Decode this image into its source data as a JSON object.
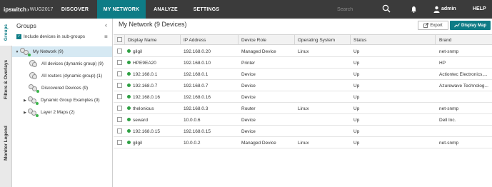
{
  "topbar": {
    "brand": "ipswitch",
    "version": "WUG2017",
    "nav": [
      "DISCOVER",
      "MY NETWORK",
      "ANALYZE",
      "SETTINGS"
    ],
    "active_nav": "MY NETWORK",
    "search_placeholder": "Search",
    "user": "admin",
    "help": "HELP"
  },
  "vertical_tabs": [
    "Groups",
    "Filters & Overlays",
    "Monitor Legend"
  ],
  "groups_panel": {
    "title": "Groups",
    "include_subgroups_label": "Include devices in sub-groups",
    "include_subgroups_checked": true,
    "tree": [
      {
        "label": "My Network (9)",
        "expanded": true,
        "selected": true
      },
      {
        "label": "All devices (dynamic group) (9)"
      },
      {
        "label": "All routers (dynamic group) (1)"
      },
      {
        "label": "Discovered Devices (9)"
      },
      {
        "label": "Dynamic Group Examples (9)",
        "collapsed": true
      },
      {
        "label": "Layer 2 Maps (2)",
        "collapsed": true
      }
    ]
  },
  "main": {
    "title": "My Network  (9 Devices)",
    "export_label": "Export",
    "display_map_label": "Display Map",
    "columns": [
      "Display Name",
      "IP Address",
      "Device Role",
      "Operating System",
      "Status",
      "Brand"
    ],
    "rows": [
      {
        "name": "gilgil",
        "ip": "192.168.0.20",
        "role": "Managed Device",
        "os": "Linux",
        "status": "Up",
        "brand": "net-snmp"
      },
      {
        "name": "HPE9EA20",
        "ip": "192.168.0.10",
        "role": "Printer",
        "os": "",
        "status": "Up",
        "brand": "HP"
      },
      {
        "name": "192.168.0.1",
        "ip": "192.168.0.1",
        "role": "Device",
        "os": "",
        "status": "Up",
        "brand": "Actiontec Electronics,..."
      },
      {
        "name": "192.168.0.7",
        "ip": "192.168.0.7",
        "role": "Device",
        "os": "",
        "status": "Up",
        "brand": "Azurewave Technolog..."
      },
      {
        "name": "192.168.0.16",
        "ip": "192.168.0.16",
        "role": "Device",
        "os": "",
        "status": "Up",
        "brand": ""
      },
      {
        "name": "thelonious",
        "ip": "192.168.0.3",
        "role": "Router",
        "os": "Linux",
        "status": "Up",
        "brand": "net-snmp"
      },
      {
        "name": "seward",
        "ip": "10.0.0.6",
        "role": "Device",
        "os": "",
        "status": "Up",
        "brand": "Dell Inc."
      },
      {
        "name": "192.168.0.15",
        "ip": "192.168.0.15",
        "role": "Device",
        "os": "",
        "status": "Up",
        "brand": ""
      },
      {
        "name": "gilgil",
        "ip": "10.0.0.2",
        "role": "Managed Device",
        "os": "Linux",
        "status": "Up",
        "brand": "net-snmp"
      }
    ]
  },
  "colors": {
    "accent": "#0e7c86",
    "topbar": "#3b3b3b",
    "status_up": "#2ea043"
  }
}
